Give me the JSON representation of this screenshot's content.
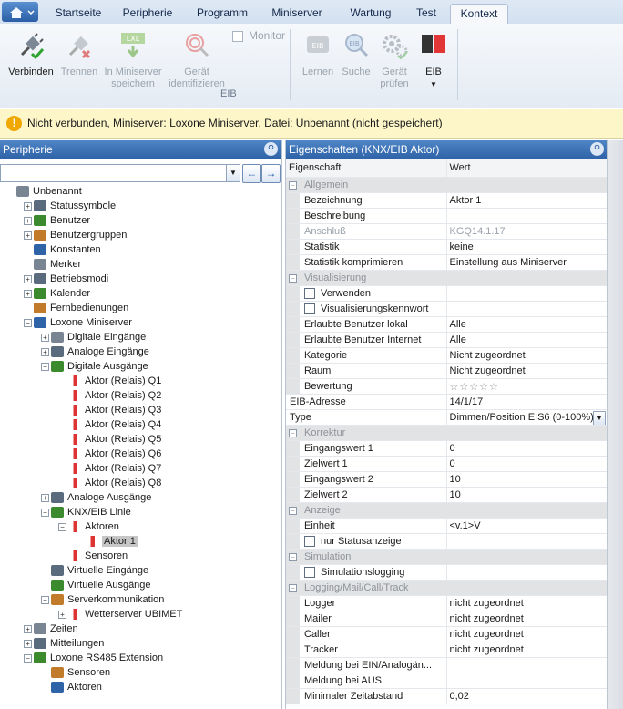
{
  "menu": {
    "tabs": [
      "Startseite",
      "Peripherie",
      "Programm",
      "Miniserver",
      "Wartung",
      "Test",
      "Kontext"
    ],
    "active_tab": "Kontext"
  },
  "ribbon": {
    "connect": "Verbinden",
    "disconnect": "Trennen",
    "save_ms": "In Miniserver speichern",
    "save_icon_text": "LXL",
    "identify": "Gerät identifizieren",
    "monitor": "Monitor",
    "learn": "Lernen",
    "learn_icon_text": "EIB",
    "search": "Suche",
    "search_icon_text": "EIB",
    "check": "Gerät prüfen",
    "eib": "EIB",
    "group_label": "EIB"
  },
  "infobar": {
    "text": "Nicht verbunden, Miniserver: Loxone Miniserver, Datei: Unbenannt (nicht gespeichert)"
  },
  "left": {
    "title": "Peripherie",
    "tree": [
      {
        "label": "Unbenannt",
        "level": 0,
        "exp": ""
      },
      {
        "label": "Statussymbole",
        "level": 1,
        "exp": "+"
      },
      {
        "label": "Benutzer",
        "level": 1,
        "exp": "+"
      },
      {
        "label": "Benutzergruppen",
        "level": 1,
        "exp": "+"
      },
      {
        "label": "Konstanten",
        "level": 1,
        "exp": ""
      },
      {
        "label": "Merker",
        "level": 1,
        "exp": ""
      },
      {
        "label": "Betriebsmodi",
        "level": 1,
        "exp": "+"
      },
      {
        "label": "Kalender",
        "level": 1,
        "exp": "+"
      },
      {
        "label": "Fernbedienungen",
        "level": 1,
        "exp": ""
      },
      {
        "label": "Loxone Miniserver",
        "level": 1,
        "exp": "-"
      },
      {
        "label": "Digitale Eingänge",
        "level": 2,
        "exp": "+"
      },
      {
        "label": "Analoge Eingänge",
        "level": 2,
        "exp": "+"
      },
      {
        "label": "Digitale Ausgänge",
        "level": 2,
        "exp": "-"
      },
      {
        "label": "Aktor (Relais) Q1",
        "level": 3,
        "exp": ""
      },
      {
        "label": "Aktor (Relais) Q2",
        "level": 3,
        "exp": ""
      },
      {
        "label": "Aktor (Relais) Q3",
        "level": 3,
        "exp": ""
      },
      {
        "label": "Aktor (Relais) Q4",
        "level": 3,
        "exp": ""
      },
      {
        "label": "Aktor (Relais) Q5",
        "level": 3,
        "exp": ""
      },
      {
        "label": "Aktor (Relais) Q6",
        "level": 3,
        "exp": ""
      },
      {
        "label": "Aktor (Relais) Q7",
        "level": 3,
        "exp": ""
      },
      {
        "label": "Aktor (Relais) Q8",
        "level": 3,
        "exp": ""
      },
      {
        "label": "Analoge Ausgänge",
        "level": 2,
        "exp": "+"
      },
      {
        "label": "KNX/EIB Linie",
        "level": 2,
        "exp": "-"
      },
      {
        "label": "Aktoren",
        "level": 3,
        "exp": "-"
      },
      {
        "label": "Aktor 1",
        "level": 4,
        "exp": "",
        "selected": true
      },
      {
        "label": "Sensoren",
        "level": 3,
        "exp": ""
      },
      {
        "label": "Virtuelle Eingänge",
        "level": 2,
        "exp": ""
      },
      {
        "label": "Virtuelle Ausgänge",
        "level": 2,
        "exp": ""
      },
      {
        "label": "Serverkommunikation",
        "level": 2,
        "exp": "-"
      },
      {
        "label": "Wetterserver UBIMET",
        "level": 3,
        "exp": "+"
      },
      {
        "label": "Zeiten",
        "level": 1,
        "exp": "+"
      },
      {
        "label": "Mitteilungen",
        "level": 1,
        "exp": "+"
      },
      {
        "label": "Loxone RS485 Extension",
        "level": 1,
        "exp": "-"
      },
      {
        "label": "Sensoren",
        "level": 2,
        "exp": ""
      },
      {
        "label": "Aktoren",
        "level": 2,
        "exp": ""
      }
    ]
  },
  "right": {
    "title": "Eigenschaften (KNX/EIB Aktor)",
    "header": {
      "k": "Eigenschaft",
      "v": "Wert"
    },
    "rows": [
      {
        "type": "cat",
        "k": "Allgemein"
      },
      {
        "type": "row",
        "k": "Bezeichnung",
        "v": "Aktor 1",
        "indent": true
      },
      {
        "type": "row",
        "k": "Beschreibung",
        "v": "",
        "indent": true
      },
      {
        "type": "row",
        "k": "Anschluß",
        "v": "KGQ14.1.17",
        "indent": true,
        "dim": true
      },
      {
        "type": "row",
        "k": "Statistik",
        "v": "keine",
        "indent": true
      },
      {
        "type": "row",
        "k": "Statistik komprimieren",
        "v": "Einstellung aus Miniserver",
        "indent": true
      },
      {
        "type": "cat",
        "k": "Visualisierung"
      },
      {
        "type": "check",
        "k": "Verwenden",
        "v": "",
        "indent": true
      },
      {
        "type": "check",
        "k": "Visualisierungskennwort",
        "v": "",
        "indent": true
      },
      {
        "type": "row",
        "k": "Erlaubte Benutzer lokal",
        "v": "Alle",
        "indent": true
      },
      {
        "type": "row",
        "k": "Erlaubte Benutzer Internet",
        "v": "Alle",
        "indent": true
      },
      {
        "type": "row",
        "k": "Kategorie",
        "v": "Nicht zugeordnet",
        "indent": true
      },
      {
        "type": "row",
        "k": "Raum",
        "v": "Nicht zugeordnet",
        "indent": true
      },
      {
        "type": "row",
        "k": "Bewertung",
        "v": "☆☆☆☆☆",
        "indent": true
      },
      {
        "type": "row",
        "k": "EIB-Adresse",
        "v": "14/1/17",
        "indent": false
      },
      {
        "type": "select",
        "k": "Type",
        "v": "Dimmen/Position EIS6 (0-100%)",
        "indent": false
      },
      {
        "type": "cat",
        "k": "Korrektur"
      },
      {
        "type": "row",
        "k": "Eingangswert 1",
        "v": "0",
        "indent": true
      },
      {
        "type": "row",
        "k": "Zielwert 1",
        "v": "0",
        "indent": true
      },
      {
        "type": "row",
        "k": "Eingangswert 2",
        "v": "10",
        "indent": true
      },
      {
        "type": "row",
        "k": "Zielwert 2",
        "v": "10",
        "indent": true
      },
      {
        "type": "cat",
        "k": "Anzeige"
      },
      {
        "type": "row",
        "k": "Einheit",
        "v": "<v.1>V",
        "indent": true
      },
      {
        "type": "check",
        "k": "nur Statusanzeige",
        "v": "",
        "indent": true
      },
      {
        "type": "cat",
        "k": "Simulation"
      },
      {
        "type": "check",
        "k": "Simulationslogging",
        "v": "",
        "indent": true
      },
      {
        "type": "cat",
        "k": "Logging/Mail/Call/Track"
      },
      {
        "type": "row",
        "k": "Logger",
        "v": "nicht zugeordnet",
        "indent": true
      },
      {
        "type": "row",
        "k": "Mailer",
        "v": "nicht zugeordnet",
        "indent": true
      },
      {
        "type": "row",
        "k": "Caller",
        "v": "nicht zugeordnet",
        "indent": true
      },
      {
        "type": "row",
        "k": "Tracker",
        "v": "nicht zugeordnet",
        "indent": true
      },
      {
        "type": "row",
        "k": "Meldung bei EIN/Analogän...",
        "v": "",
        "indent": true
      },
      {
        "type": "row",
        "k": "Meldung bei AUS",
        "v": "",
        "indent": true
      },
      {
        "type": "row",
        "k": "Minimaler Zeitabstand",
        "v": "0,02",
        "indent": true
      }
    ]
  }
}
